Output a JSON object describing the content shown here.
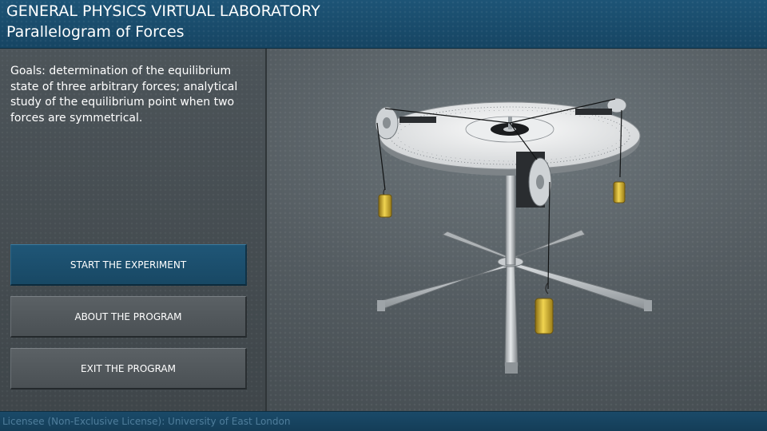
{
  "header": {
    "title": "GENERAL PHYSICS VIRTUAL LABORATORY",
    "subtitle": "Parallelogram of Forces"
  },
  "goals": {
    "text": "Goals: determination of the equilibrium state of three arbitrary forces; analytical study of the equilibrium point when two forces are symmetrical."
  },
  "menu": {
    "start_label": "START THE EXPERIMENT",
    "about_label": "ABOUT THE PROGRAM",
    "exit_label": "EXIT THE PROGRAM"
  },
  "footer": {
    "license": "Licensee (Non-Exclusive License): University of East London"
  },
  "colors": {
    "header_blue": "#1d5476",
    "primary_button": "#1f5677",
    "secondary_button": "#52585c",
    "weight_brass": "#c9a82a"
  },
  "icons": {
    "apparatus": "force-table-apparatus"
  }
}
